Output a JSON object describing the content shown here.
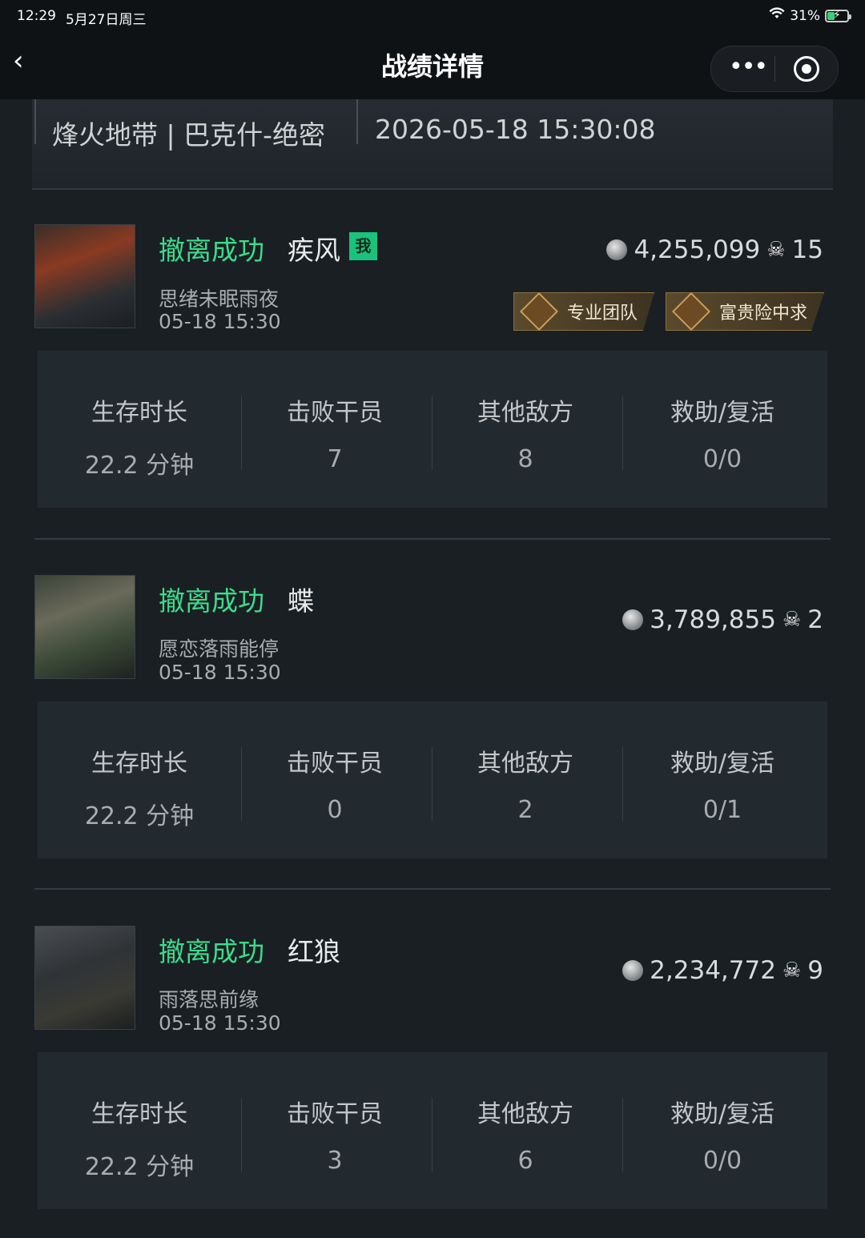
{
  "status_bar": {
    "time": "12:29",
    "date": "5月27日周三",
    "battery": "31%"
  },
  "nav": {
    "title": "战绩详情"
  },
  "match": {
    "mode": "烽火地带 | 巴克什-绝密",
    "datetime": "2026-05-18 15:30:08"
  },
  "players": [
    {
      "status": "撤离成功",
      "name": "疾风",
      "me_tag": "我",
      "username": "思绪未眠雨夜",
      "time": "05-18 15:30",
      "value": "4,255,099",
      "kills": "15",
      "badges": [
        "专业团队",
        "富贵险中求"
      ],
      "stats": {
        "labels": [
          "生存时长",
          "击败干员",
          "其他敌方",
          "救助/复活"
        ],
        "values": [
          "22.2 分钟",
          "7",
          "8",
          "0/0"
        ]
      }
    },
    {
      "status": "撤离成功",
      "name": "蝶",
      "username": "愿恋落雨能停",
      "time": "05-18 15:30",
      "value": "3,789,855",
      "kills": "2",
      "stats": {
        "labels": [
          "生存时长",
          "击败干员",
          "其他敌方",
          "救助/复活"
        ],
        "values": [
          "22.2 分钟",
          "0",
          "2",
          "0/1"
        ]
      }
    },
    {
      "status": "撤离成功",
      "name": "红狼",
      "username": "雨落思前缘",
      "time": "05-18 15:30",
      "value": "2,234,772",
      "kills": "9",
      "stats": {
        "labels": [
          "生存时长",
          "击败干员",
          "其他敌方",
          "救助/复活"
        ],
        "values": [
          "22.2 分钟",
          "3",
          "6",
          "0/0"
        ]
      }
    }
  ]
}
